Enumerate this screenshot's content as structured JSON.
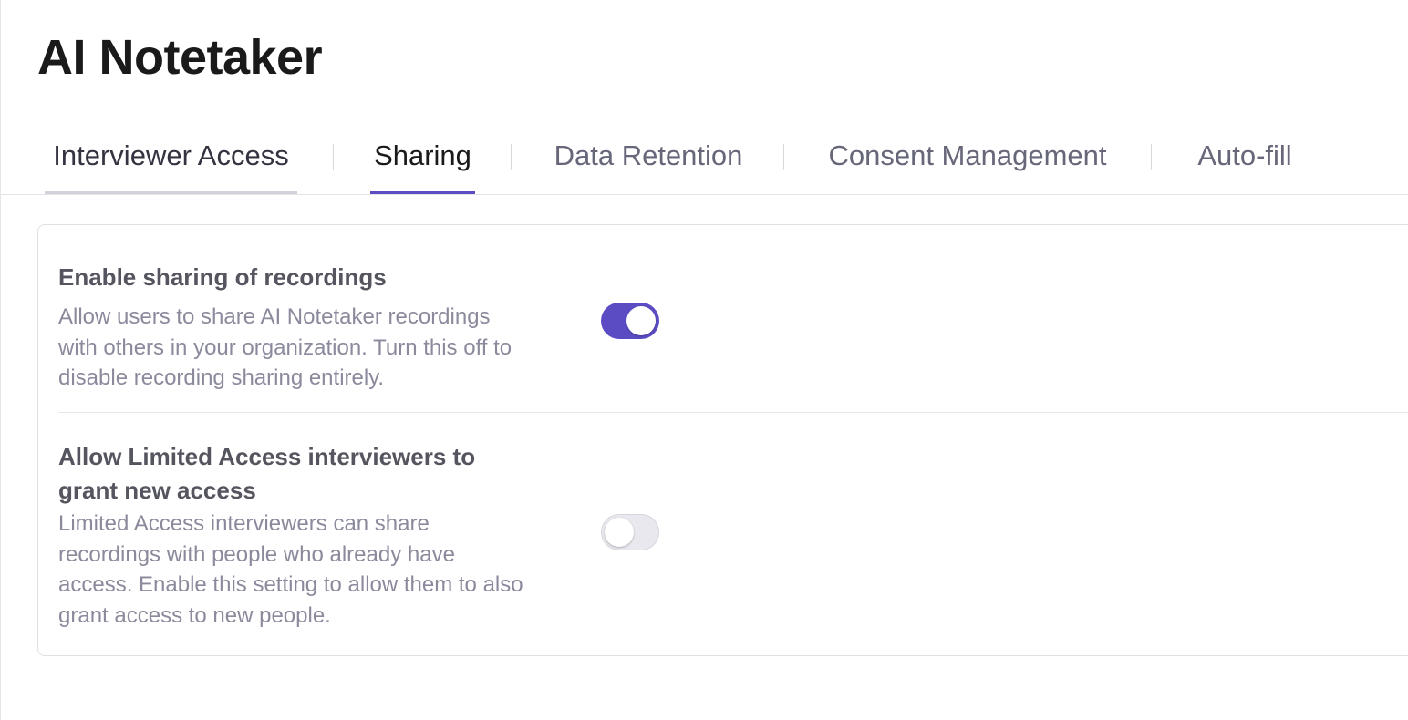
{
  "page": {
    "title": "AI Notetaker"
  },
  "tabs": [
    {
      "label": "Interviewer Access",
      "state": "visited"
    },
    {
      "label": "Sharing",
      "state": "active"
    },
    {
      "label": "Data Retention",
      "state": "inactive"
    },
    {
      "label": "Consent Management",
      "state": "inactive"
    },
    {
      "label": "Auto-fill",
      "state": "inactive"
    }
  ],
  "settings": [
    {
      "title": "Enable sharing of recordings",
      "description": "Allow users to share AI Notetaker recordings with others in your organization. Turn this off to disable recording sharing entirely.",
      "enabled": true
    },
    {
      "title": "Allow Limited Access interviewers to grant new access",
      "description": "Limited Access interviewers can share recordings with people who already have access. Enable this setting to allow them to also grant access to new people.",
      "enabled": false
    }
  ],
  "colors": {
    "accent": "#5b4cc4",
    "toggle_off": "#e8e8ee",
    "title_text": "#1a1a1a",
    "description_text": "#8a8a9c"
  }
}
